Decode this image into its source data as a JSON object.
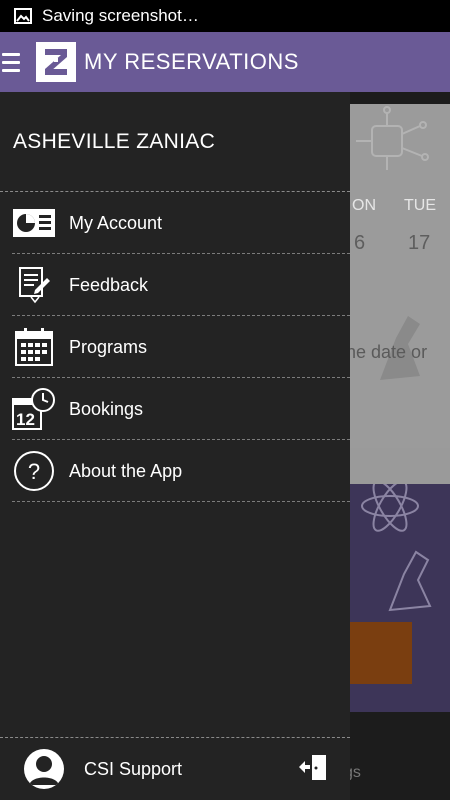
{
  "status_bar": {
    "icon": "image-icon",
    "text": "Saving screenshot…"
  },
  "app_bar": {
    "menu_icon": "hamburger-icon",
    "logo_letter": "Z",
    "title": "MY RESERVATIONS",
    "color": "#6a5a96"
  },
  "drawer": {
    "header": "ASHEVILLE ZANIAC",
    "items": [
      {
        "label": "My Account",
        "icon": "account-card-icon"
      },
      {
        "label": "Feedback",
        "icon": "feedback-pencil-icon"
      },
      {
        "label": "Programs",
        "icon": "calendar-icon"
      },
      {
        "label": "Bookings",
        "icon": "calendar-clock-icon"
      },
      {
        "label": "About the App",
        "icon": "question-circle-icon"
      }
    ],
    "footer": {
      "label": "CSI Support",
      "avatar_icon": "user-avatar-icon",
      "action_icon": "logout-door-icon"
    }
  },
  "background": {
    "day_headers": [
      "ON",
      "TUE"
    ],
    "day_numbers": [
      "6",
      "17"
    ],
    "message_fragment": "he date or",
    "bottom_fragment": "gs",
    "accent_orange": "#7a3e10"
  }
}
